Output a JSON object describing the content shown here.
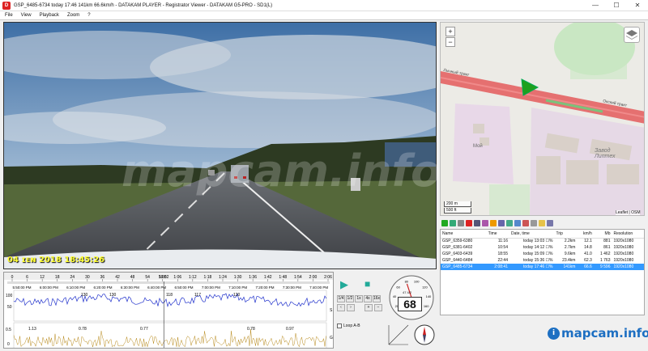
{
  "window": {
    "title": "GSP_6485-6734    today 17:46    141km    66.6km/h  -  DATAKAM PLAYER - Registrator Viewer  -  DATAKAM G5-PRO - SD1(L)",
    "app_icon_text": "D",
    "minimize": "—",
    "maximize": "☐",
    "close": "✕"
  },
  "menu": [
    "File",
    "View",
    "Playback",
    "Zoom",
    "?"
  ],
  "video": {
    "osd_text": "04 ɪᴇɴ 2018  18:45:26",
    "watermark": "mapcam.info"
  },
  "map": {
    "zoom_in": "+",
    "zoom_out": "−",
    "labels": {
      "road": "Лычный тракт",
      "road2": "Окский тракт",
      "area": "Мой",
      "factory": "Завод\nЛиптех"
    },
    "scale_m": "200 m",
    "scale_ft": "500 ft",
    "attribution": "Leaflet | OSM",
    "colors": {
      "route": "#e45a5a",
      "arrow": "#1ea01e",
      "road_green": "#7bc27b",
      "building": "#d9d0c9"
    }
  },
  "filelist": {
    "columns": [
      "Name",
      "Time",
      "Date, time",
      "Trip",
      "km/h",
      "Mb",
      "Resolution"
    ],
    "rows": [
      [
        "GSP_6359-6380",
        "11:16",
        "today 13:03 ☐%",
        "2.2km",
        "12.1",
        "881",
        "1920x1080"
      ],
      [
        "GSP_6381-6402",
        "10:54",
        "today 14:12 ☐%",
        "2.7km",
        "14.8",
        "861",
        "1920x1080"
      ],
      [
        "GSP_6403-6439",
        "18:55",
        "today 15:09 ☐%",
        "9.6km",
        "41.0",
        "1 462",
        "1920x1080"
      ],
      [
        "GSP_6440-6484",
        "22:44",
        "today 15:36 ☐%",
        "23.4km",
        "62.3",
        "1 763",
        "1920x1080"
      ],
      [
        "GSP_6485-6734",
        "2:08:41",
        "today 17:46 ☐%",
        "141km",
        "66.6",
        "9 596",
        "1920x1080"
      ]
    ],
    "selected_index": 4
  },
  "brand": {
    "logo_glyph": "i",
    "text": "mapcam.info"
  },
  "timeline": {
    "ruler": [
      "0",
      "6",
      "12",
      "18",
      "24",
      "30",
      "36",
      "42",
      "48",
      "54",
      "1:00",
      "1:06",
      "1:12",
      "1:18",
      "1:24",
      "1:30",
      "1:36",
      "1:42",
      "1:48",
      "1:54",
      "2:00",
      "2:06"
    ],
    "cursor": "59:52",
    "clock": [
      "5:50:00 PM",
      "6:00:00 PM",
      "6:10:00 PM",
      "6:20:00 PM",
      "6:30:00 PM",
      "6:40:00 PM",
      "6:50:00 PM",
      "7:00:00 PM",
      "7:10:00 PM",
      "7:20:00 PM",
      "7:30:00 PM",
      "7:40:00 PM",
      "7:50:00 PM"
    ],
    "speed_axis": [
      "100",
      "50"
    ],
    "speed_peaks": [
      "130",
      "130",
      "118",
      "117",
      "120"
    ],
    "speed_tag": "S",
    "g_axis": [
      "0.5",
      "0"
    ],
    "g_peaks": [
      "1.13",
      "0.78",
      "0.77",
      "0.78",
      "0.97"
    ],
    "g_tag": "G",
    "colors": {
      "speed": "#2233cc",
      "g": "#b88a1c"
    }
  },
  "controls": {
    "play": "▶",
    "stop": "■",
    "speeds": [
      "1/4",
      "1/2",
      "1x",
      "4x",
      "16x",
      "64x"
    ],
    "loop_label": "Loop A-B"
  },
  "gauge": {
    "speed": "68",
    "readout": "47 4/2",
    "ticks": [
      "20",
      "40",
      "60",
      "80",
      "100",
      "120",
      "140",
      "160"
    ]
  }
}
